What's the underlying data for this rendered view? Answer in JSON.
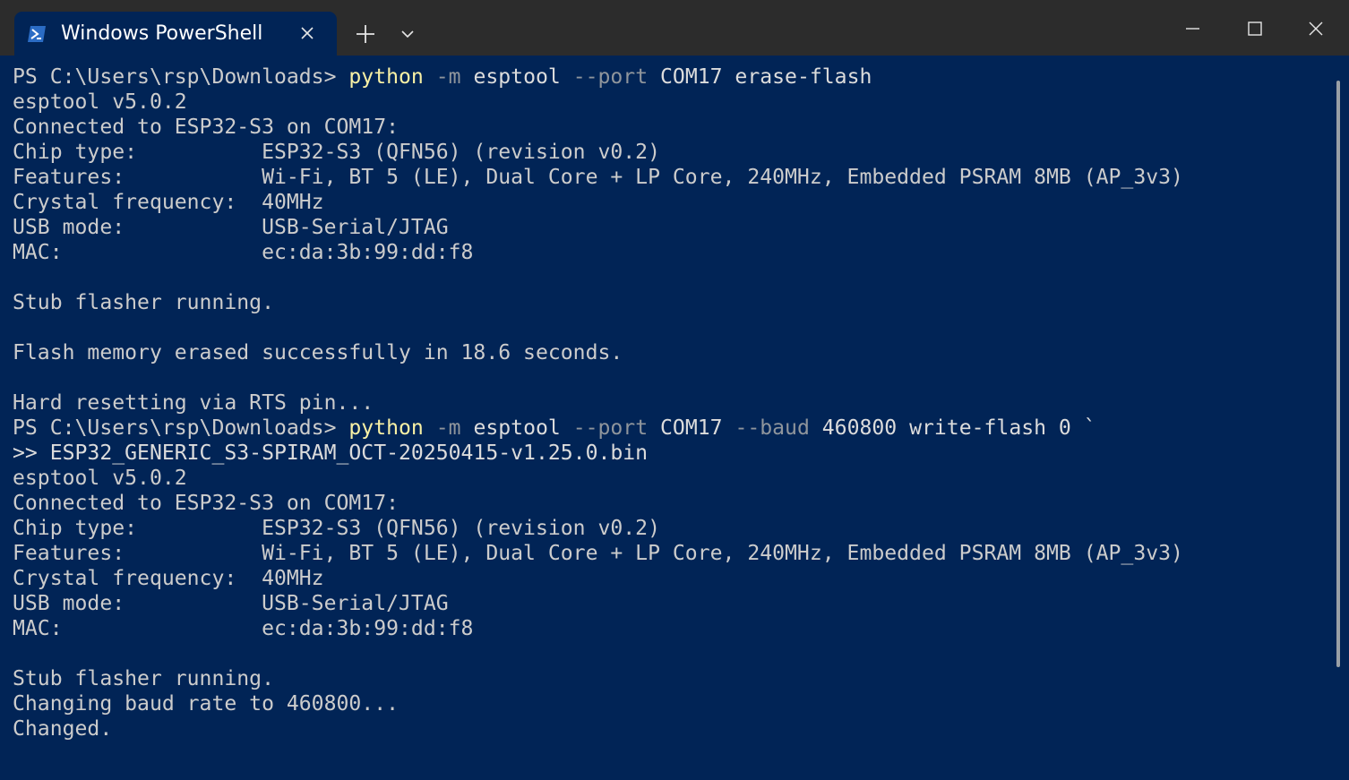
{
  "titlebar": {
    "tab_title": "Windows PowerShell",
    "tab_icon": "powershell-icon",
    "close_tab_icon": "close-icon",
    "new_tab_icon": "plus-icon",
    "dropdown_icon": "chevron-down-icon",
    "minimize_icon": "minimize-icon",
    "maximize_icon": "maximize-icon",
    "close_window_icon": "close-icon"
  },
  "colors": {
    "terminal_background": "#012456",
    "titlebar_background": "#2c2c2c",
    "command_color": "#f9f1a5",
    "flag_color": "#8f959c",
    "output_color": "#cccccc"
  },
  "terminal": {
    "lines": [
      {
        "segments": [
          {
            "t": "PS C:\\Users\\rsp\\Downloads> ",
            "k": "out"
          },
          {
            "t": "python",
            "k": "cmd"
          },
          {
            "t": " ",
            "k": "out"
          },
          {
            "t": "-m",
            "k": "flag"
          },
          {
            "t": " esptool ",
            "k": "arg"
          },
          {
            "t": "--port",
            "k": "flag"
          },
          {
            "t": " COM17 erase-flash",
            "k": "arg"
          }
        ]
      },
      {
        "segments": [
          {
            "t": "esptool v5.0.2",
            "k": "out"
          }
        ]
      },
      {
        "segments": [
          {
            "t": "Connected to ESP32-S3 on COM17:",
            "k": "out"
          }
        ]
      },
      {
        "segments": [
          {
            "t": "Chip type:          ESP32-S3 (QFN56) (revision v0.2)",
            "k": "out"
          }
        ]
      },
      {
        "segments": [
          {
            "t": "Features:           Wi-Fi, BT 5 (LE), Dual Core + LP Core, 240MHz, Embedded PSRAM 8MB (AP_3v3)",
            "k": "out"
          }
        ]
      },
      {
        "segments": [
          {
            "t": "Crystal frequency:  40MHz",
            "k": "out"
          }
        ]
      },
      {
        "segments": [
          {
            "t": "USB mode:           USB-Serial/JTAG",
            "k": "out"
          }
        ]
      },
      {
        "segments": [
          {
            "t": "MAC:                ec:da:3b:99:dd:f8",
            "k": "out"
          }
        ]
      },
      {
        "segments": [
          {
            "t": "",
            "k": "out"
          }
        ]
      },
      {
        "segments": [
          {
            "t": "Stub flasher running.",
            "k": "out"
          }
        ]
      },
      {
        "segments": [
          {
            "t": "",
            "k": "out"
          }
        ]
      },
      {
        "segments": [
          {
            "t": "Flash memory erased successfully in 18.6 seconds.",
            "k": "out"
          }
        ]
      },
      {
        "segments": [
          {
            "t": "",
            "k": "out"
          }
        ]
      },
      {
        "segments": [
          {
            "t": "Hard resetting via RTS pin...",
            "k": "out"
          }
        ]
      },
      {
        "segments": [
          {
            "t": "PS C:\\Users\\rsp\\Downloads> ",
            "k": "out"
          },
          {
            "t": "python",
            "k": "cmd"
          },
          {
            "t": " ",
            "k": "out"
          },
          {
            "t": "-m",
            "k": "flag"
          },
          {
            "t": " esptool ",
            "k": "arg"
          },
          {
            "t": "--port",
            "k": "flag"
          },
          {
            "t": " COM17 ",
            "k": "arg"
          },
          {
            "t": "--baud",
            "k": "flag"
          },
          {
            "t": " 460800 write-flash 0 `",
            "k": "arg"
          }
        ]
      },
      {
        "segments": [
          {
            "t": ">> ESP32_GENERIC_S3-SPIRAM_OCT-20250415-v1.25.0.bin",
            "k": "arg"
          }
        ]
      },
      {
        "segments": [
          {
            "t": "esptool v5.0.2",
            "k": "out"
          }
        ]
      },
      {
        "segments": [
          {
            "t": "Connected to ESP32-S3 on COM17:",
            "k": "out"
          }
        ]
      },
      {
        "segments": [
          {
            "t": "Chip type:          ESP32-S3 (QFN56) (revision v0.2)",
            "k": "out"
          }
        ]
      },
      {
        "segments": [
          {
            "t": "Features:           Wi-Fi, BT 5 (LE), Dual Core + LP Core, 240MHz, Embedded PSRAM 8MB (AP_3v3)",
            "k": "out"
          }
        ]
      },
      {
        "segments": [
          {
            "t": "Crystal frequency:  40MHz",
            "k": "out"
          }
        ]
      },
      {
        "segments": [
          {
            "t": "USB mode:           USB-Serial/JTAG",
            "k": "out"
          }
        ]
      },
      {
        "segments": [
          {
            "t": "MAC:                ec:da:3b:99:dd:f8",
            "k": "out"
          }
        ]
      },
      {
        "segments": [
          {
            "t": "",
            "k": "out"
          }
        ]
      },
      {
        "segments": [
          {
            "t": "Stub flasher running.",
            "k": "out"
          }
        ]
      },
      {
        "segments": [
          {
            "t": "Changing baud rate to 460800...",
            "k": "out"
          }
        ]
      },
      {
        "segments": [
          {
            "t": "Changed.",
            "k": "out"
          }
        ]
      }
    ]
  }
}
